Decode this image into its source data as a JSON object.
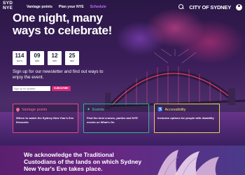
{
  "nav": {
    "logo": "SYD NYE",
    "links": [
      "Vantage points",
      "Plan your NYE",
      "Schedule"
    ],
    "brand": "CITY OF SYDNEY"
  },
  "hero": {
    "title": "One night, many ways to celebrate!",
    "countdown": [
      {
        "value": "114",
        "label": "DAYS"
      },
      {
        "value": "09",
        "label": "HRS"
      },
      {
        "value": "12",
        "label": "MIN"
      },
      {
        "value": "25",
        "label": "SEC"
      }
    ],
    "newsletter_text": "Sign up for our newsletter and find out ways to enjoy the event.",
    "signup_placeholder": "Sign up for updates",
    "signup_button": "SUBSCRIBE"
  },
  "cards": [
    {
      "title": "Vantage points",
      "body": "Where to watch the Sydney New Year's Eve fireworks",
      "color": "#e54b82",
      "icon": "location-pin-icon"
    },
    {
      "title": "Events",
      "body": "Find the best cruises, parties and NYE events on What's On",
      "color": "#2ab88a",
      "icon": "sparkle-icon"
    },
    {
      "title": "Accessibility",
      "body": "Inclusive options for people with disability",
      "color": "#e8d25a",
      "icon": "accessibility-icon"
    }
  ],
  "acknowledgement": "We acknowledge the Traditional Custodians of the lands on which Sydney New Year's Eve takes place."
}
